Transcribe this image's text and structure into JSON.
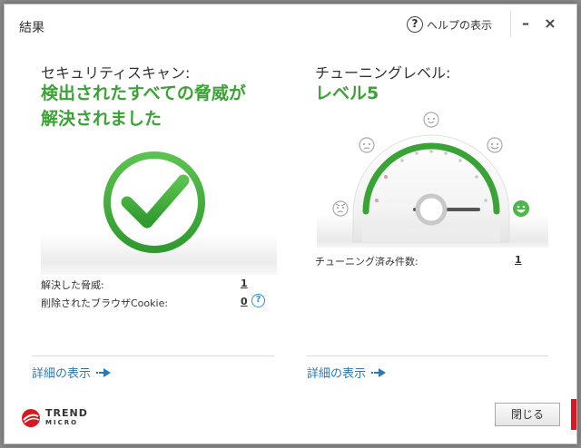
{
  "window": {
    "title": "結果"
  },
  "titlebar": {
    "help_label": "ヘルプの表示",
    "help_icon": "?",
    "minimize": "–",
    "close": "×"
  },
  "scan": {
    "heading": "セキュリティスキャン:",
    "result_line1": "検出されたすべての脅威が",
    "result_line2": "解決されました",
    "resolved_label": "解決した脅威:",
    "resolved_value": "1",
    "cookies_label": "削除されたブラウザCookie:",
    "cookies_value": "0",
    "details_link": "詳細の表示"
  },
  "tuning": {
    "heading": "チューニングレベル:",
    "level": "レベル5",
    "level_value": 5,
    "level_max": 5,
    "count_label": "チューニング済み件数:",
    "count_value": "1",
    "details_link": "詳細の表示"
  },
  "logo": {
    "line1": "TREND",
    "line2": "MICRO"
  },
  "footer": {
    "close_button": "閉じる"
  },
  "colors": {
    "green": "#3aa335",
    "link": "#2a7ab8",
    "brand_red": "#d71920",
    "help_blue": "#2d8fd5"
  }
}
